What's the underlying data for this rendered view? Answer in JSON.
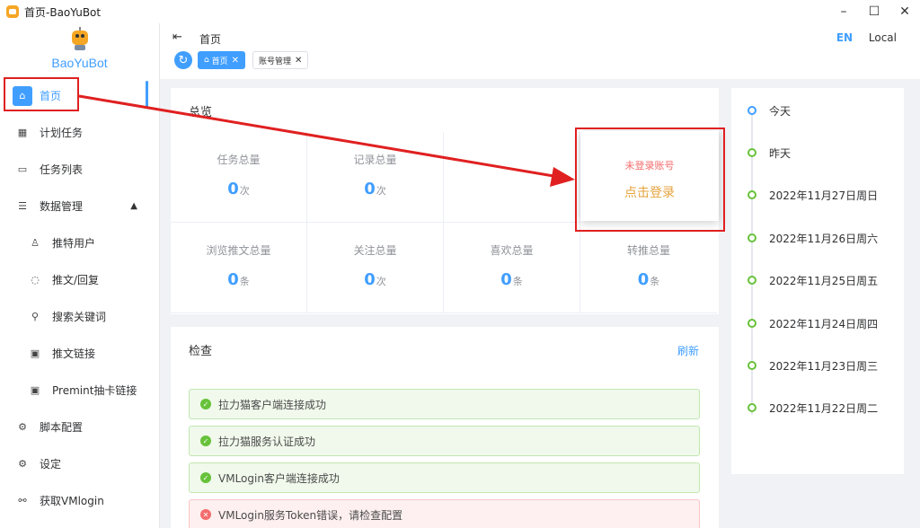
{
  "window": {
    "title": "首页-BaoYuBot",
    "minimize": "–",
    "maximize": "☐",
    "close": "✕"
  },
  "sidebar": {
    "logo_text": "BaoYuBot",
    "items": [
      {
        "label": "首页",
        "icon": "home-icon"
      },
      {
        "label": "计划任务",
        "icon": "calendar-icon"
      },
      {
        "label": "任务列表",
        "icon": "monitor-icon"
      },
      {
        "label": "数据管理",
        "icon": "list-icon"
      },
      {
        "label": "推特用户",
        "icon": "user-icon"
      },
      {
        "label": "推文/回复",
        "icon": "chat-icon"
      },
      {
        "label": "搜索关键词",
        "icon": "search-icon"
      },
      {
        "label": "推文链接",
        "icon": "link-icon"
      },
      {
        "label": "Premint抽卡链接",
        "icon": "link-icon"
      },
      {
        "label": "脚本配置",
        "icon": "gear-icon"
      },
      {
        "label": "设定",
        "icon": "gear-icon"
      },
      {
        "label": "获取VMlogin",
        "icon": "link-icon"
      }
    ]
  },
  "header": {
    "breadcrumb": "首页",
    "lang_en": "EN",
    "lang_local": "Local",
    "tabs": [
      {
        "label": "首页"
      },
      {
        "label": "账号管理"
      }
    ]
  },
  "overview": {
    "title": "总览",
    "stats": [
      {
        "label": "任务总量",
        "value": "0",
        "unit": "次"
      },
      {
        "label": "记录总量",
        "value": "0",
        "unit": "次"
      },
      {
        "label": "浏览推文总量",
        "value": "0",
        "unit": "条"
      },
      {
        "label": "关注总量",
        "value": "0",
        "unit": "次"
      },
      {
        "label": "喜欢总量",
        "value": "0",
        "unit": "条"
      },
      {
        "label": "转推总量",
        "value": "0",
        "unit": "条"
      }
    ],
    "login": {
      "status": "未登录账号",
      "action": "点击登录"
    }
  },
  "check": {
    "title": "检查",
    "refresh": "刷新",
    "alerts": [
      {
        "text": "拉力猫客户端连接成功",
        "type": "ok"
      },
      {
        "text": "拉力猫服务认证成功",
        "type": "ok"
      },
      {
        "text": "VMLogin客户端连接成功",
        "type": "ok"
      },
      {
        "text": "VMLogin服务Token错误，请检查配置",
        "type": "err"
      }
    ]
  },
  "timeline": [
    "今天",
    "昨天",
    "2022年11月27日周日",
    "2022年11月26日周六",
    "2022年11月25日周五",
    "2022年11月24日周四",
    "2022年11月23日周三",
    "2022年11月22日周二"
  ],
  "colors": {
    "primary": "#409eff",
    "success": "#67c23a",
    "danger": "#f56c6c",
    "warning": "#e6a23c",
    "annotation": "#e02020"
  }
}
